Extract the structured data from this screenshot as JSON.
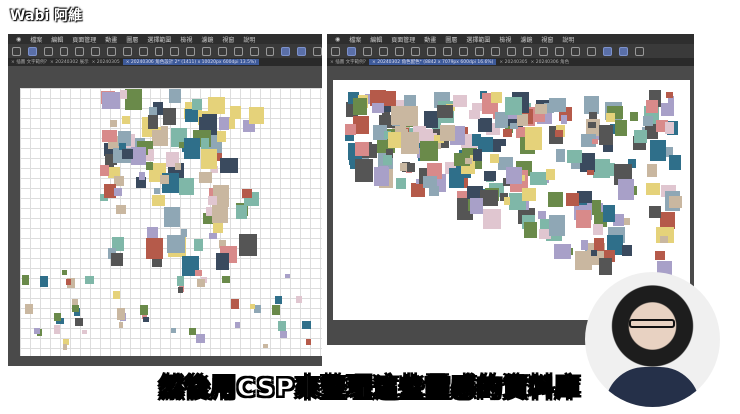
{
  "channel_title": "Wabi 阿維",
  "subtitle": "然後用CSP來整理這些靈感的資料庫",
  "menu": [
    "檔案",
    "編輯",
    "頁面管理",
    "動畫",
    "圖層",
    "選擇範圍",
    "檢視",
    "濾鏡",
    "視窗",
    "說明"
  ],
  "left_window": {
    "tabs": [
      "插圖 文字範例?",
      "20240302 展示",
      "20240305",
      "20240306 角色設計 2* (1411) x 10020px 600dpi 13.5%)"
    ],
    "active_tab": 3
  },
  "right_window": {
    "tabs": [
      "插圖 文字範例?",
      "20240302 角色配色* (8842 x 7079px 600dpi 16.6%)",
      "20240305",
      "20240306 角色"
    ],
    "active_tab": 1
  },
  "colors": {
    "menu_bg": "#2e2e2e",
    "active_tab": "#3d5a9a",
    "canvas_bg": "#4a4a4a"
  }
}
